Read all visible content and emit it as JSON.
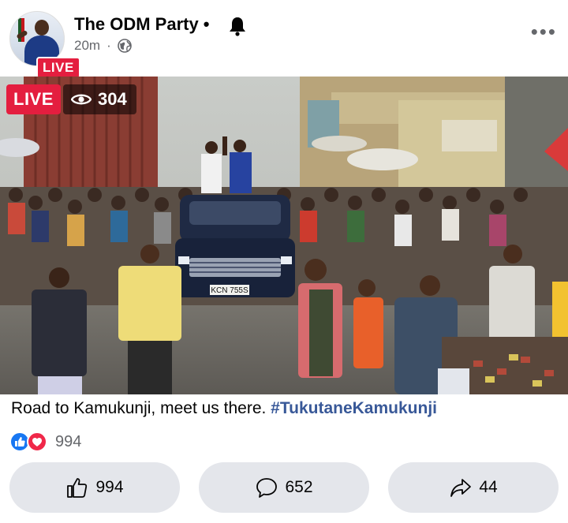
{
  "post": {
    "page_name": "The ODM Party",
    "separator": "•",
    "time_ago": "20m",
    "meta_separator": "·",
    "avatar_badge": "LIVE"
  },
  "video": {
    "live_label": "LIVE",
    "viewer_count": "304",
    "plate_text": "KCN 755S"
  },
  "caption": {
    "text": "Road to Kamukunji, meet us there. ",
    "hashtag": "#TukutaneKamukunji"
  },
  "reactions": {
    "count": "994",
    "icons": [
      "like-icon",
      "love-icon"
    ]
  },
  "actions": {
    "like_count": "994",
    "comment_count": "652",
    "share_count": "44"
  },
  "colors": {
    "live_red": "#e41e3f",
    "like_blue": "#1877f2",
    "love_red": "#f02849",
    "hashtag_blue": "#385898",
    "button_bg": "#e4e6eb",
    "meta_gray": "#65676b"
  }
}
